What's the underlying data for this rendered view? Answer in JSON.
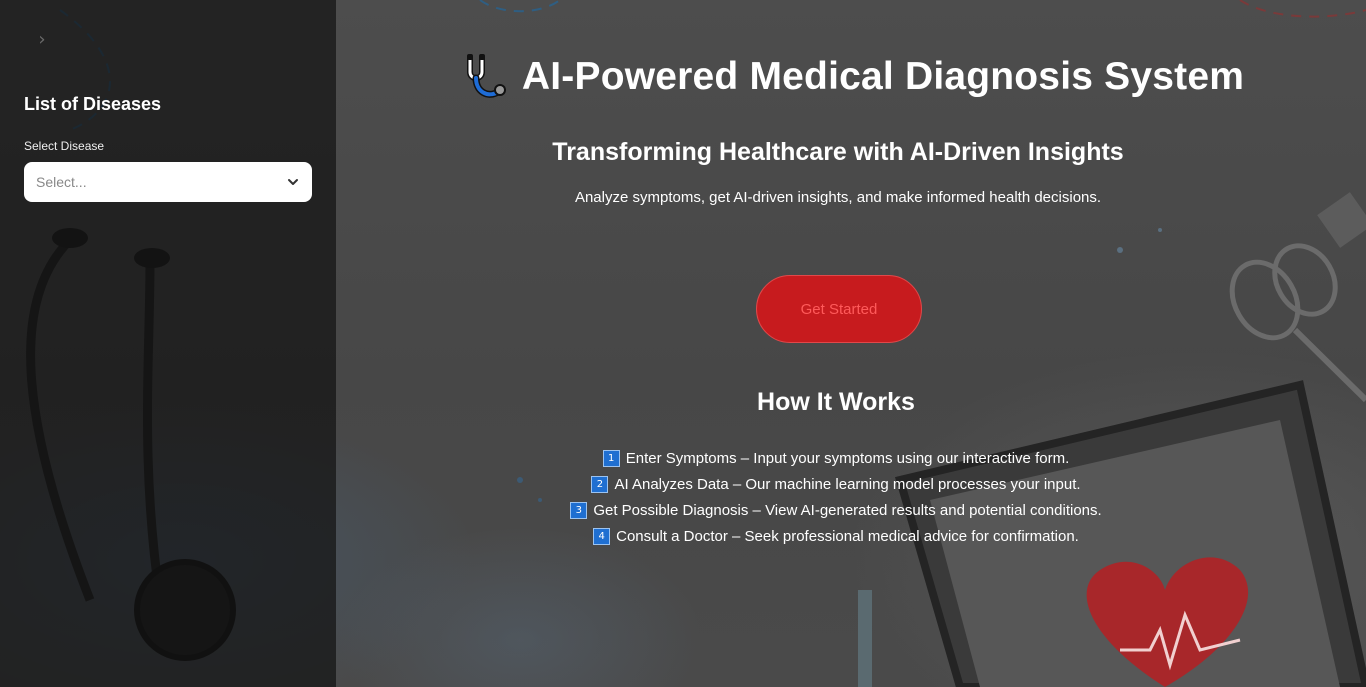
{
  "sidebar": {
    "collapse_glyph": "›",
    "title": "List of Diseases",
    "select_label": "Select Disease",
    "select_placeholder": "Select..."
  },
  "main": {
    "title": "AI-Powered Medical Diagnosis System",
    "title_icon": "stethoscope-icon",
    "subtitle": "Transforming Healthcare with AI-Driven Insights",
    "tagline": "Analyze symptoms, get AI-driven insights, and make informed health decisions.",
    "cta_label": "Get Started",
    "how_title": "How It Works",
    "steps": [
      {
        "num": "1",
        "text": "Enter Symptoms – Input your symptoms using our interactive form."
      },
      {
        "num": "2",
        "text": "AI Analyzes Data – Our machine learning model processes your input."
      },
      {
        "num": "3",
        "text": "Get Possible Diagnosis – View AI-generated results and potential conditions."
      },
      {
        "num": "4",
        "text": "Consult a Doctor – Seek professional medical advice for confirmation."
      }
    ]
  },
  "colors": {
    "accent_red": "#c71b1e",
    "badge_blue": "#1f6fd1",
    "sidebar_bg": "#141414"
  }
}
